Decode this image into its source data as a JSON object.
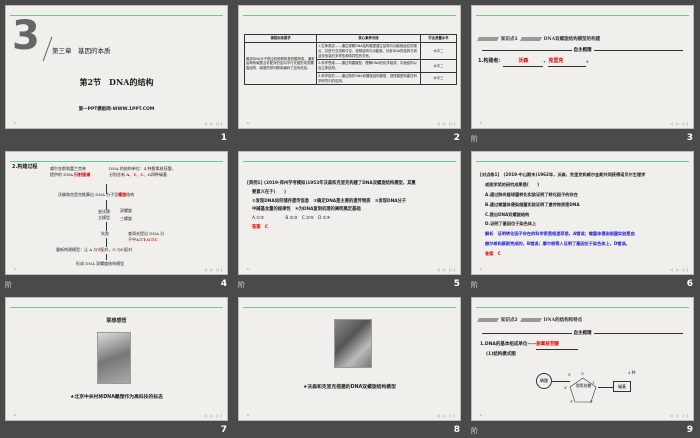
{
  "slides": [
    {
      "number": "1",
      "chapter_num": "3",
      "chapter": "第三章　基因的本质",
      "title": "第2节　DNA的结构",
      "footer": "第一PPT模板网-WWW.1PPT.COM"
    },
    {
      "number": "2",
      "headers": [
        "课程标准要求",
        "核心素养对接",
        "学业质量水平"
      ],
      "requirement": "概述DNA分子是由四种脱氧核苷酸构成，通常由两条碱基互补配对的反向平行长链形成双螺旋结构，碱基的排列顺序编码了遗传信息。",
      "rows": [
        {
          "core": "1.生命观念——通过观察DNA结构模型建立结构与功能相适应的观点，并进行交流和讨论，说明结构与功能观。分析DNA的结构与其遗传信息的多样性和特异性的关系。",
          "level": "水平二"
        },
        {
          "core": "2.科学思维——通过构建模型，理解DNA的化学组成、平面结构以及立体结构。",
          "level": "水平二"
        },
        {
          "core": "3.科学探究——通过制作DNA双螺旋结构模型，领悟模型构建在科学研究中的应用。",
          "level": "水平三"
        }
      ]
    },
    {
      "number": "3",
      "side_label": "阶",
      "kp_label": "知识点1",
      "kp_title": "DNA双螺旋结构模型的构建",
      "section": "自主梳理",
      "q1": "1.构建者：",
      "a1": "沃森",
      "a2": "克里克",
      "end": "。"
    },
    {
      "number": "4",
      "side_label": "阶",
      "heading": "2.构建过程",
      "n1a": "威尔金斯和富兰克林",
      "n1b": "提供的 DNA",
      "n1red": "衍射图谱",
      "n2a": "DNA 的结构单位：4 种脱氧核苷酸，",
      "n2b": "分别含有",
      "n2red": "A、T、C、G",
      "n2c": "四种碱基",
      "n3": "沃森和克里克推算出 DNA 分子呈",
      "n3red": "螺旋",
      "n3end": "结构",
      "n4a": "尝试建",
      "n4b": "立模型",
      "n4c": "双螺旋",
      "n4d": "三螺旋",
      "n5": "失败",
      "n6a": "查哥夫提出 DNA 分",
      "n6b": "子中",
      "n6red": "A＝T,G＝C",
      "n7a": "重新构建模型：让 A 与",
      "n7r1": "T",
      "n7b": "配对，G 与",
      "n7r2": "C",
      "n7c": "配对",
      "n8": "形成 DNA 双螺旋结构模型"
    },
    {
      "number": "5",
      "side_label": "阶",
      "q": "[典例1] (2019·郑州学考模拟)1953年沃森和克里克构建了DNA双螺旋结构模型，其重",
      "q2": "要意义在于(　　)",
      "opt1": "①发现DNA如何储存遗传信息　②确定DNA是主要的遗传物质　③发现DNA分子",
      "opt2": "中碱基含量的规律性　④为DNA复制机理的阐明奠定基础",
      "choices": "A.①③　　　　　B.②③　C.②④　D.①④",
      "answer": "答案　C"
    },
    {
      "number": "6",
      "side_label": "阶",
      "q": "[对点练1]　(2019·中山期末)1962年，沃森、克里克和威尔金斯共同获得诺贝尔生理学",
      "q2": "或医学奖的研究成果是(　　)",
      "a": "A.通过肺炎链球菌转化实验证明了转化因子的存在",
      "b": "B.通过噬菌体侵染细菌实验证明了遗传物质是DNA",
      "c": "C.提出DNA双螺旋结构",
      "d": "D.证明了基因位于染色体上",
      "exp1": "解析　证明转化因子存在的科学家是格里菲思，A错误；噬菌体侵染细菌实验是由",
      "exp2": "赫尔希和蔡斯完成的，B错误；摩尔根等人证明了基因位于染色体上，D错误。",
      "answer": "答案　C"
    },
    {
      "number": "7",
      "title": "联想感悟",
      "caption": "★北京中关村将DNA雕塑作为高科技的标志"
    },
    {
      "number": "8",
      "caption": "★沃森和克里克搭建的DNA双螺旋结构模型"
    },
    {
      "number": "9",
      "side_label": "阶",
      "kp_label": "知识点2",
      "kp_title": "DNA的结构和特点",
      "section": "自主梳理",
      "q1": "1.DNA的基本组成单位——",
      "a1": "脱氧核苷酸",
      "q2": "(1)结构模式图",
      "phosphate": "磷酸",
      "sugar": "脱氧核糖",
      "base": "碱基",
      "o": "O",
      "c5": "5'",
      "c4": "4'",
      "c3": "3'",
      "c2": "2'",
      "c1": "1'",
      "types": "4 种"
    }
  ],
  "nav": "◁ ▷ ▷|"
}
